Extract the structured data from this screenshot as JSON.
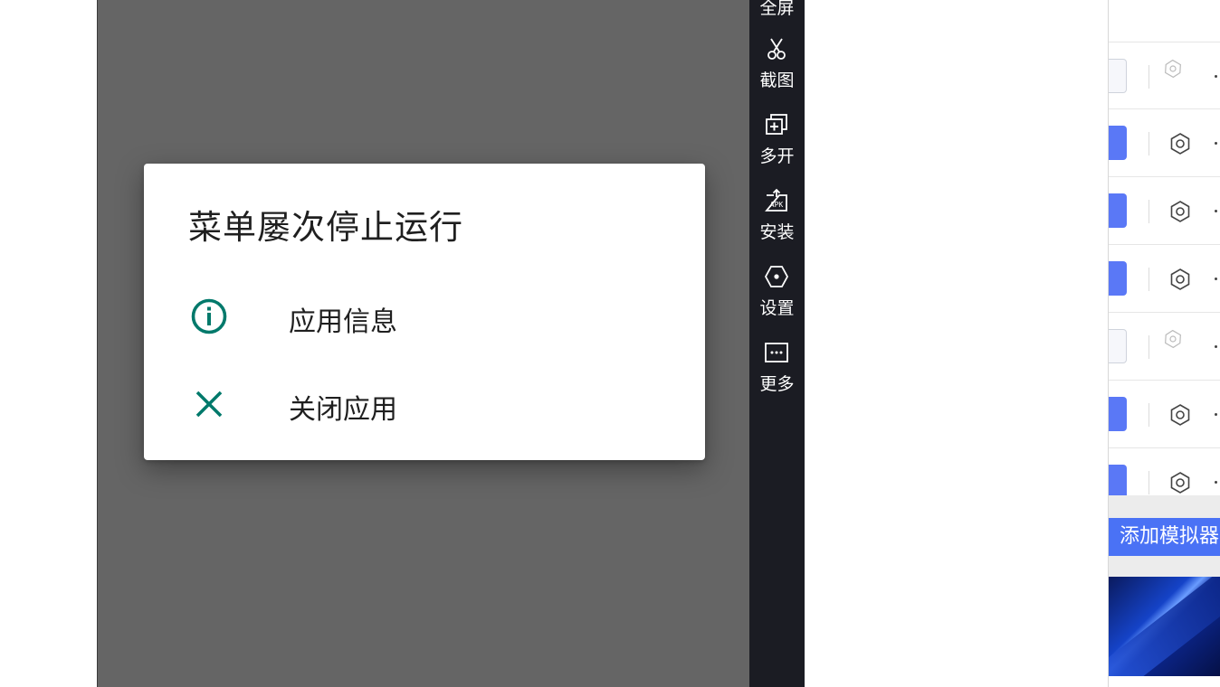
{
  "dialog": {
    "title": "菜单屡次停止运行",
    "options": [
      {
        "label": "应用信息",
        "icon": "info-icon"
      },
      {
        "label": "关闭应用",
        "icon": "close-icon"
      }
    ],
    "icon_color": "#00796b"
  },
  "toolbar": {
    "items": [
      {
        "label": "全屏",
        "icon": "fullscreen-icon"
      },
      {
        "label": "截图",
        "icon": "scissors-icon"
      },
      {
        "label": "多开",
        "icon": "multi-window-icon"
      },
      {
        "label": "安装",
        "icon": "apk-install-icon"
      },
      {
        "label": "设置",
        "icon": "hex-settings-icon"
      },
      {
        "label": "更多",
        "icon": "more-icon"
      }
    ]
  },
  "instances": {
    "rows": [
      {
        "state": "off"
      },
      {
        "state": "on"
      },
      {
        "state": "on"
      },
      {
        "state": "on"
      },
      {
        "state": "off"
      },
      {
        "state": "on"
      },
      {
        "state": "on"
      }
    ],
    "add_button": "添加模拟器"
  },
  "colors": {
    "accent": "#5a78f6",
    "toolbar_bg": "#1b1c23",
    "emulator_bg": "#656565"
  }
}
